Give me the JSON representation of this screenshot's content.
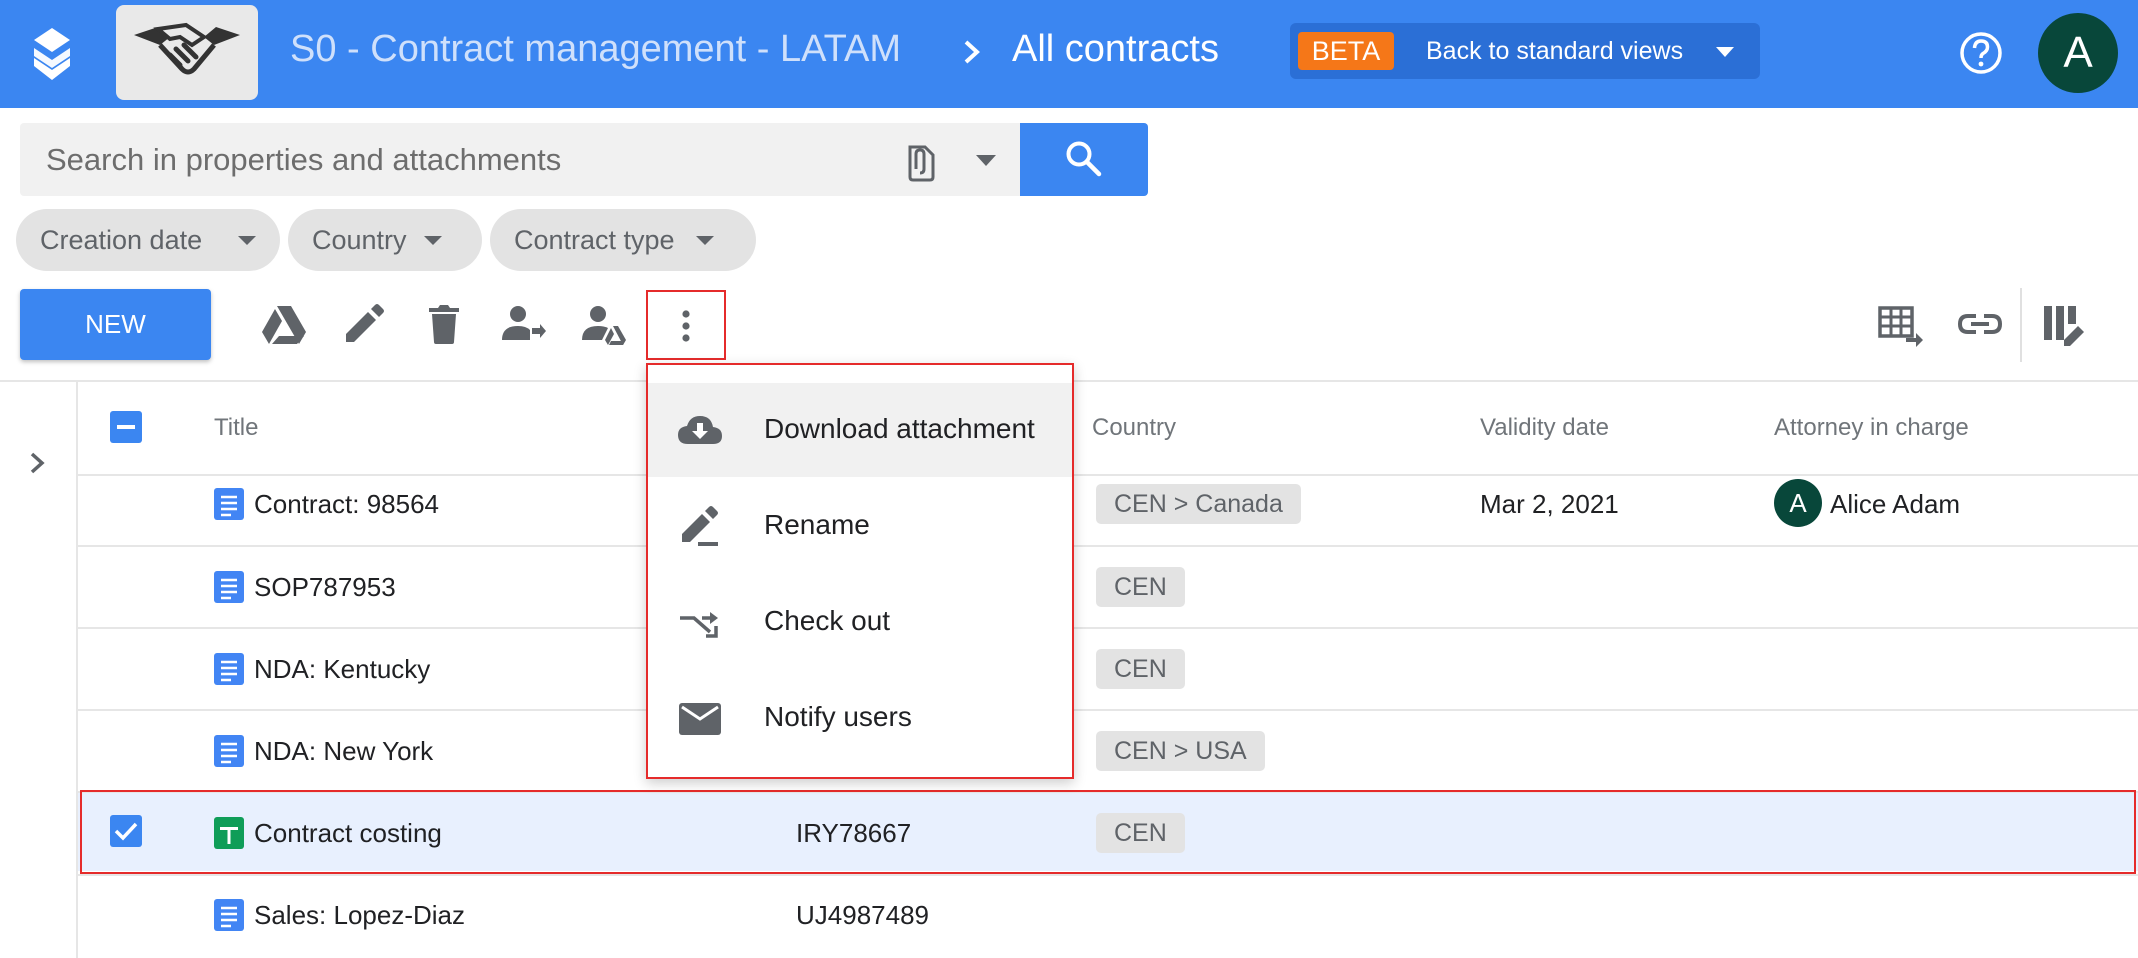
{
  "header": {
    "folder_name": "S0 - Contract management - LATAM",
    "current_view": "All contracts",
    "beta_badge": "BETA",
    "beta_link": "Back to standard views",
    "avatar_initial": "A",
    "bar_color": "#3b86f1"
  },
  "search": {
    "placeholder": "Search in properties and attachments",
    "value": ""
  },
  "filters": [
    "Creation date",
    "Country",
    "Contract type"
  ],
  "toolbar": {
    "new_label": "NEW",
    "icons": [
      "drive-icon",
      "edit-icon",
      "delete-icon",
      "assign-user-icon",
      "share-user-icon",
      "more-vert-icon"
    ],
    "right_icons": [
      "export-sheet-icon",
      "link-icon",
      "column-settings-icon"
    ]
  },
  "table": {
    "columns": [
      "Title",
      "Country",
      "Validity date",
      "Attorney in charge"
    ],
    "rows": [
      {
        "title": "Contract: 98564",
        "icon": "doc-icon",
        "reference": "",
        "country": "CEN  >  Canada",
        "validity": "Mar 2, 2021",
        "attorney": "Alice Adam",
        "attorney_initial": "A",
        "selected": false
      },
      {
        "title": "SOP787953",
        "icon": "doc-icon",
        "reference": "",
        "country": "CEN",
        "validity": "",
        "attorney": "",
        "selected": false
      },
      {
        "title": "NDA: Kentucky",
        "icon": "doc-icon",
        "reference": "",
        "country": "CEN",
        "validity": "",
        "attorney": "",
        "selected": false
      },
      {
        "title": "NDA: New York",
        "icon": "doc-icon",
        "reference": "",
        "country": "CEN  >  USA",
        "validity": "",
        "attorney": "",
        "selected": false
      },
      {
        "title": "Contract costing",
        "icon": "sheet-icon",
        "reference": "IRY78667",
        "country": "CEN",
        "validity": "",
        "attorney": "",
        "selected": true
      },
      {
        "title": "Sales: Lopez-Diaz",
        "icon": "doc-icon",
        "reference": "UJ4987489",
        "country": "",
        "validity": "",
        "attorney": "",
        "selected": false
      }
    ]
  },
  "context_menu": {
    "items": [
      {
        "label": "Download attachment",
        "icon": "cloud-download-icon"
      },
      {
        "label": "Rename",
        "icon": "rename-icon"
      },
      {
        "label": "Check out",
        "icon": "checkout-icon"
      },
      {
        "label": "Notify users",
        "icon": "mail-icon"
      }
    ]
  },
  "colors": {
    "accent": "#3b86f1",
    "beta": "#f57718",
    "highlight_outline": "#e52b2b",
    "selected_row": "#e8f0fe"
  }
}
